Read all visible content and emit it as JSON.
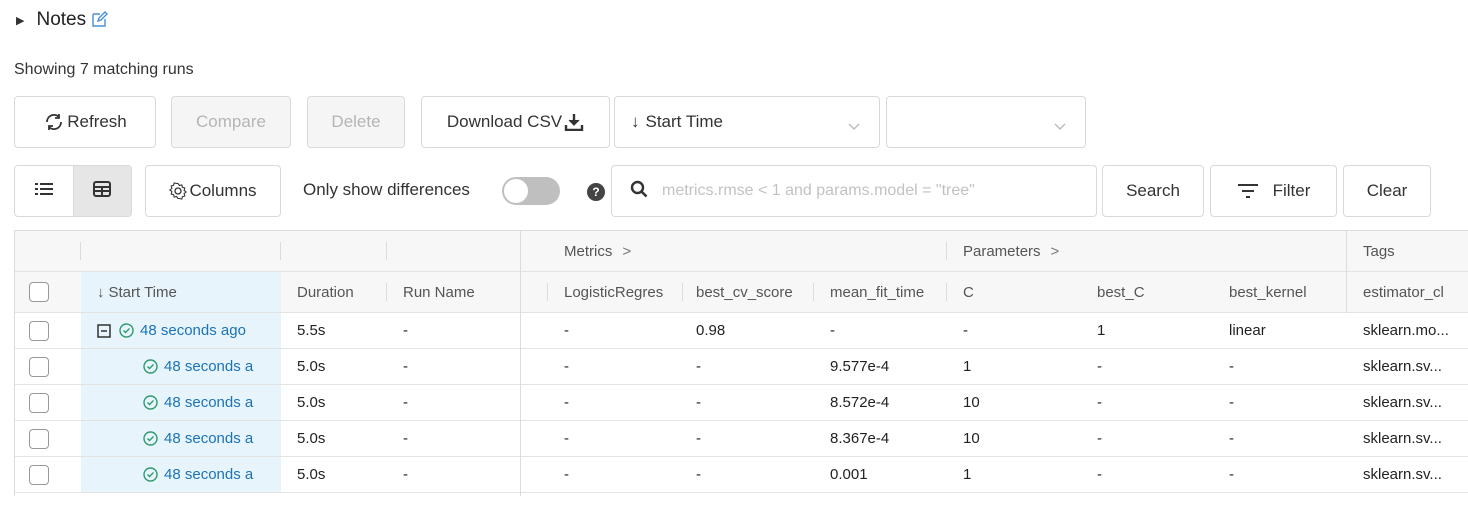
{
  "notes": {
    "caret": "▶",
    "title": "Notes"
  },
  "summary": {
    "showing_text": "Showing 7 matching runs"
  },
  "toolbar": {
    "refresh_label": "Refresh",
    "compare_label": "Compare",
    "delete_label": "Delete",
    "download_label": "Download CSV",
    "sort_prefix": "↓",
    "sort_value": "Start Time",
    "second_select_value": ""
  },
  "filters": {
    "columns_label": "Columns",
    "only_diff_label": "Only show differences",
    "only_diff_on": false,
    "help_glyph": "?",
    "search_placeholder": "metrics.rmse < 1 and params.model = \"tree\"",
    "search_label": "Search",
    "filter_label": "Filter",
    "clear_label": "Clear"
  },
  "table": {
    "groups": {
      "metrics": "Metrics",
      "parameters": "Parameters",
      "tags": "Tags",
      "chevron": ">"
    },
    "columns": [
      "Start Time",
      "Duration",
      "Run Name",
      "LogisticRegres",
      "best_cv_score",
      "mean_fit_time",
      "C",
      "best_C",
      "best_kernel",
      "estimator_cl"
    ],
    "sort_arrow": "↓",
    "rows": [
      {
        "expand": "⊟",
        "start": "48 seconds ago",
        "duration": "5.5s",
        "run_name": "-",
        "logreg": "-",
        "best_cv_score": "0.98",
        "mean_fit_time": "-",
        "c": "-",
        "best_c": "1",
        "best_kernel": "linear",
        "estimator": "sklearn.mo..."
      },
      {
        "expand": "",
        "start": "48 seconds a",
        "duration": "5.0s",
        "run_name": "-",
        "logreg": "-",
        "best_cv_score": "-",
        "mean_fit_time": "9.577e-4",
        "c": "1",
        "best_c": "-",
        "best_kernel": "-",
        "estimator": "sklearn.sv..."
      },
      {
        "expand": "",
        "start": "48 seconds a",
        "duration": "5.0s",
        "run_name": "-",
        "logreg": "-",
        "best_cv_score": "-",
        "mean_fit_time": "8.572e-4",
        "c": "10",
        "best_c": "-",
        "best_kernel": "-",
        "estimator": "sklearn.sv..."
      },
      {
        "expand": "",
        "start": "48 seconds a",
        "duration": "5.0s",
        "run_name": "-",
        "logreg": "-",
        "best_cv_score": "-",
        "mean_fit_time": "8.367e-4",
        "c": "10",
        "best_c": "-",
        "best_kernel": "-",
        "estimator": "sklearn.sv..."
      },
      {
        "expand": "",
        "start": "48 seconds a",
        "duration": "5.0s",
        "run_name": "-",
        "logreg": "-",
        "best_cv_score": "-",
        "mean_fit_time": "0.001",
        "c": "1",
        "best_c": "-",
        "best_kernel": "-",
        "estimator": "sklearn.sv..."
      }
    ]
  },
  "colors": {
    "accent_link": "#1a73b8",
    "status_ok": "#2e9a6e",
    "selected_col_bg": "#e8f4fb"
  },
  "icons": [
    "caret-right-icon",
    "edit-icon",
    "refresh-icon",
    "download-icon",
    "chevron-down-icon",
    "list-view-icon",
    "table-view-icon",
    "gear-icon",
    "help-icon",
    "search-icon",
    "filter-icon",
    "check-circle-icon",
    "collapse-icon"
  ]
}
